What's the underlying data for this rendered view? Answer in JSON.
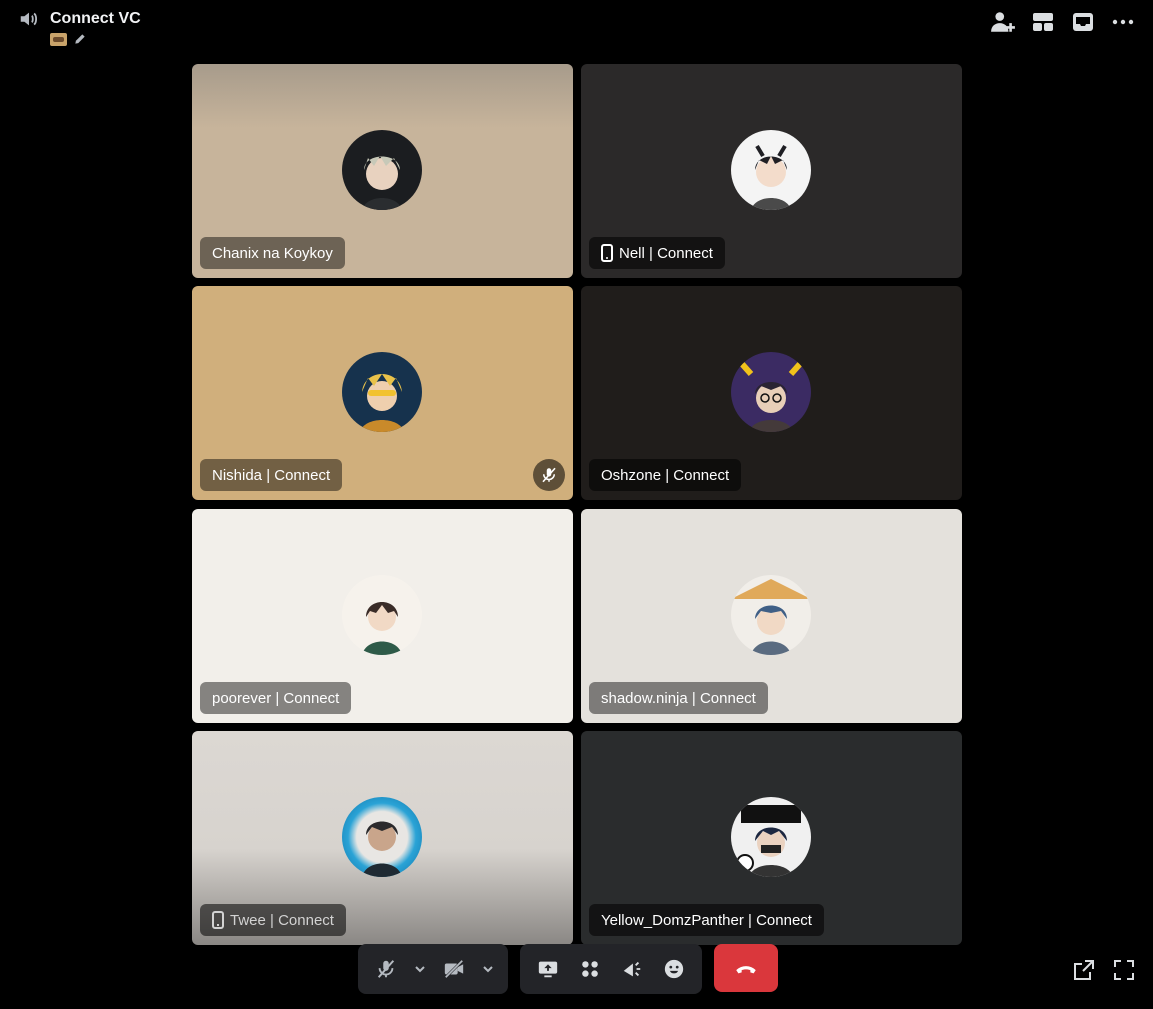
{
  "header": {
    "title": "Connect VC",
    "actions": [
      {
        "icon": "add-user-icon"
      },
      {
        "icon": "layout-icon"
      },
      {
        "icon": "inbox-icon"
      },
      {
        "icon": "more-icon"
      }
    ]
  },
  "participants": [
    {
      "name": "Chanix na Koykoy",
      "bg": "#c7b49b",
      "mobile": false,
      "muted": false,
      "avatar_bg": "#1b1d20",
      "hair": "#c7c9b8"
    },
    {
      "name": "Nell | Connect",
      "bg": "#2b2929",
      "mobile": true,
      "muted": false,
      "avatar_bg": "#f4f4f4",
      "hair": "#1f1f24"
    },
    {
      "name": "Nishida | Connect",
      "bg": "#d0af7c",
      "mobile": false,
      "muted": true,
      "avatar_bg": "#16324d",
      "hair": "#e9c24a"
    },
    {
      "name": "Oshzone | Connect",
      "bg": "#201d1b",
      "mobile": false,
      "muted": false,
      "avatar_bg": "#3b2b63",
      "hair": "#2a2433"
    },
    {
      "name": "poorever | Connect",
      "bg": "#f2efea",
      "mobile": false,
      "muted": false,
      "avatar_bg": "#f6f2ec",
      "hair": "#3a2c28"
    },
    {
      "name": "shadow.ninja | Connect",
      "bg": "#e4e1dc",
      "mobile": false,
      "muted": false,
      "avatar_bg": "#f1eee9",
      "hair": "#3f5f86"
    },
    {
      "name": "Twee | Connect",
      "bg": "#d7d3ce",
      "mobile": true,
      "muted": false,
      "avatar_bg": "#2aa3d6",
      "hair": "#2b2a2c"
    },
    {
      "name": "Yellow_DomzPanther | Connect",
      "bg": "#2a2c2d",
      "mobile": false,
      "muted": false,
      "avatar_bg": "#f0f0f0",
      "hair": "#1c2740"
    }
  ],
  "controls": {
    "colors": {
      "hangup": "#da373c",
      "group_bg": "#232428"
    }
  }
}
